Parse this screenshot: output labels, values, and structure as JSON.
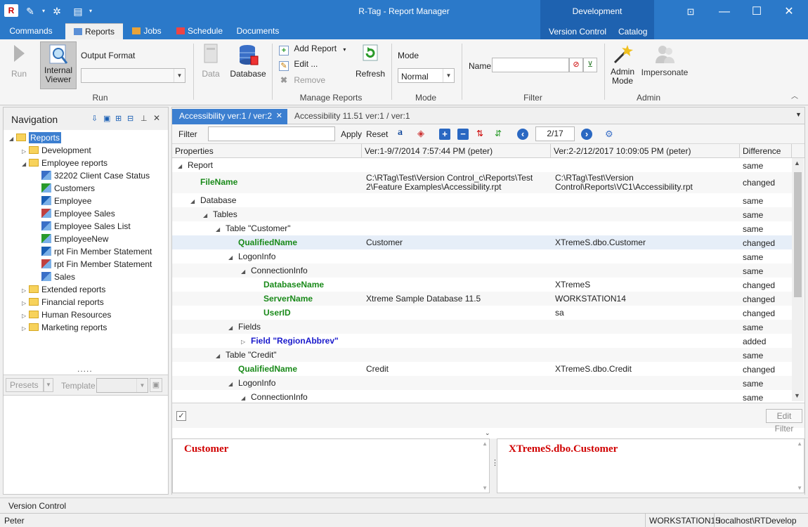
{
  "window": {
    "title": "R-Tag - Report Manager"
  },
  "context_tab": {
    "group": "Development",
    "tabs": [
      "Version Control",
      "Catalog"
    ]
  },
  "ribbon_tabs": [
    "Commands",
    "Reports",
    "Jobs",
    "Schedule",
    "Documents"
  ],
  "ribbon": {
    "run": "Run",
    "internal_viewer": "Internal\nViewer",
    "output_format": "Output Format",
    "group_run": "Run",
    "data": "Data",
    "database": "Database",
    "add_report": "Add Report",
    "edit": "Edit ...",
    "remove": "Remove",
    "refresh": "Refresh",
    "group_manage": "Manage Reports",
    "mode_label": "Mode",
    "mode_value": "Normal",
    "group_mode": "Mode",
    "name_label": "Name",
    "group_filter": "Filter",
    "admin_mode": "Admin\nMode",
    "impersonate": "Impersonate",
    "group_admin": "Admin"
  },
  "nav": {
    "title": "Navigation",
    "items": [
      {
        "label": "Reports",
        "level": 0,
        "type": "folder",
        "expanded": true,
        "selected": true
      },
      {
        "label": "Development",
        "level": 1,
        "type": "folder"
      },
      {
        "label": "Employee reports",
        "level": 1,
        "type": "folder",
        "expanded": true
      },
      {
        "label": "32202 Client Case Status",
        "level": 2,
        "type": "report"
      },
      {
        "label": "Customers",
        "level": 2,
        "type": "report"
      },
      {
        "label": "Employee",
        "level": 2,
        "type": "report"
      },
      {
        "label": "Employee  Sales",
        "level": 2,
        "type": "report"
      },
      {
        "label": "Employee Sales List",
        "level": 2,
        "type": "report"
      },
      {
        "label": "EmployeeNew",
        "level": 2,
        "type": "report"
      },
      {
        "label": "rpt Fin Member Statement",
        "level": 2,
        "type": "report"
      },
      {
        "label": "rpt Fin Member Statement",
        "level": 2,
        "type": "report"
      },
      {
        "label": "Sales",
        "level": 2,
        "type": "report"
      },
      {
        "label": "Extended reports",
        "level": 1,
        "type": "folder"
      },
      {
        "label": "Financial reports",
        "level": 1,
        "type": "folder"
      },
      {
        "label": "Human Resources",
        "level": 1,
        "type": "folder"
      },
      {
        "label": "Marketing reports",
        "level": 1,
        "type": "folder"
      }
    ],
    "presets": "Presets",
    "template": "Template"
  },
  "doc_tabs": [
    {
      "label": "Accessibility ver:1 / ver:2",
      "active": true
    },
    {
      "label": "Accessibility 11.51 ver:1 / ver:1",
      "active": false
    }
  ],
  "filterbar": {
    "filter": "Filter",
    "apply": "Apply",
    "reset": "Reset",
    "page": "2/17"
  },
  "grid": {
    "headers": [
      "Properties",
      "Ver:1-9/7/2014 7:57:44 PM (peter)",
      "Ver:2-2/12/2017 10:09:05 PM (peter)",
      "Difference"
    ],
    "rows": [
      {
        "name": "Report",
        "level": 0,
        "expand": "open",
        "style": "normal",
        "v1": "",
        "v2": "",
        "diff": "same"
      },
      {
        "name": "FileName",
        "level": 1,
        "expand": "none",
        "style": "green",
        "v1": "C:\\RTag\\Test\\Version Control_c\\Reports\\Test\n2\\Feature Examples\\Accessibility.rpt",
        "v2": "C:\\RTag\\Test\\Version\nControl\\Reports\\VC1\\Accessibility.rpt",
        "diff": "changed"
      },
      {
        "name": "Database",
        "level": 1,
        "expand": "open",
        "style": "normal",
        "v1": "",
        "v2": "",
        "diff": "same"
      },
      {
        "name": "Tables",
        "level": 2,
        "expand": "open",
        "style": "normal",
        "v1": "",
        "v2": "",
        "diff": "same"
      },
      {
        "name": "Table \"Customer\"",
        "level": 3,
        "expand": "open",
        "style": "normal",
        "v1": "",
        "v2": "",
        "diff": "same"
      },
      {
        "name": "QualifiedName",
        "level": 4,
        "expand": "none",
        "style": "green",
        "v1": "Customer",
        "v2": "XTremeS.dbo.Customer",
        "diff": "changed",
        "selected": true
      },
      {
        "name": "LogonInfo",
        "level": 4,
        "expand": "open",
        "style": "normal",
        "v1": "",
        "v2": "",
        "diff": "same"
      },
      {
        "name": "ConnectionInfo",
        "level": 5,
        "expand": "open",
        "style": "normal",
        "v1": "",
        "v2": "",
        "diff": "same"
      },
      {
        "name": "DatabaseName",
        "level": 6,
        "expand": "none",
        "style": "green",
        "v1": "",
        "v2": "XTremeS",
        "diff": "changed"
      },
      {
        "name": "ServerName",
        "level": 6,
        "expand": "none",
        "style": "green",
        "v1": "Xtreme Sample Database 11.5",
        "v2": "WORKSTATION14",
        "diff": "changed"
      },
      {
        "name": "UserID",
        "level": 6,
        "expand": "none",
        "style": "green",
        "v1": "",
        "v2": "sa",
        "diff": "changed"
      },
      {
        "name": "Fields",
        "level": 4,
        "expand": "open",
        "style": "normal",
        "v1": "",
        "v2": "",
        "diff": "same"
      },
      {
        "name": "Field \"RegionAbbrev\"",
        "level": 5,
        "expand": "closed",
        "style": "blue",
        "v1": "",
        "v2": "",
        "diff": "added"
      },
      {
        "name": "Table \"Credit\"",
        "level": 3,
        "expand": "open",
        "style": "normal",
        "v1": "",
        "v2": "",
        "diff": "same"
      },
      {
        "name": "QualifiedName",
        "level": 4,
        "expand": "none",
        "style": "green",
        "v1": "Credit",
        "v2": "XTremeS.dbo.Credit",
        "diff": "changed"
      },
      {
        "name": "LogonInfo",
        "level": 4,
        "expand": "open",
        "style": "normal",
        "v1": "",
        "v2": "",
        "diff": "same"
      },
      {
        "name": "ConnectionInfo",
        "level": 5,
        "expand": "open",
        "style": "normal",
        "v1": "",
        "v2": "",
        "diff": "same"
      }
    ]
  },
  "edit_filter": "Edit Filter",
  "preview": {
    "left": "Customer",
    "right": "XTremeS.dbo.Customer"
  },
  "version_control": "Version Control",
  "status": {
    "user": "Peter",
    "machine": "WORKSTATION15",
    "connection": "localhost\\RTDevelop"
  }
}
